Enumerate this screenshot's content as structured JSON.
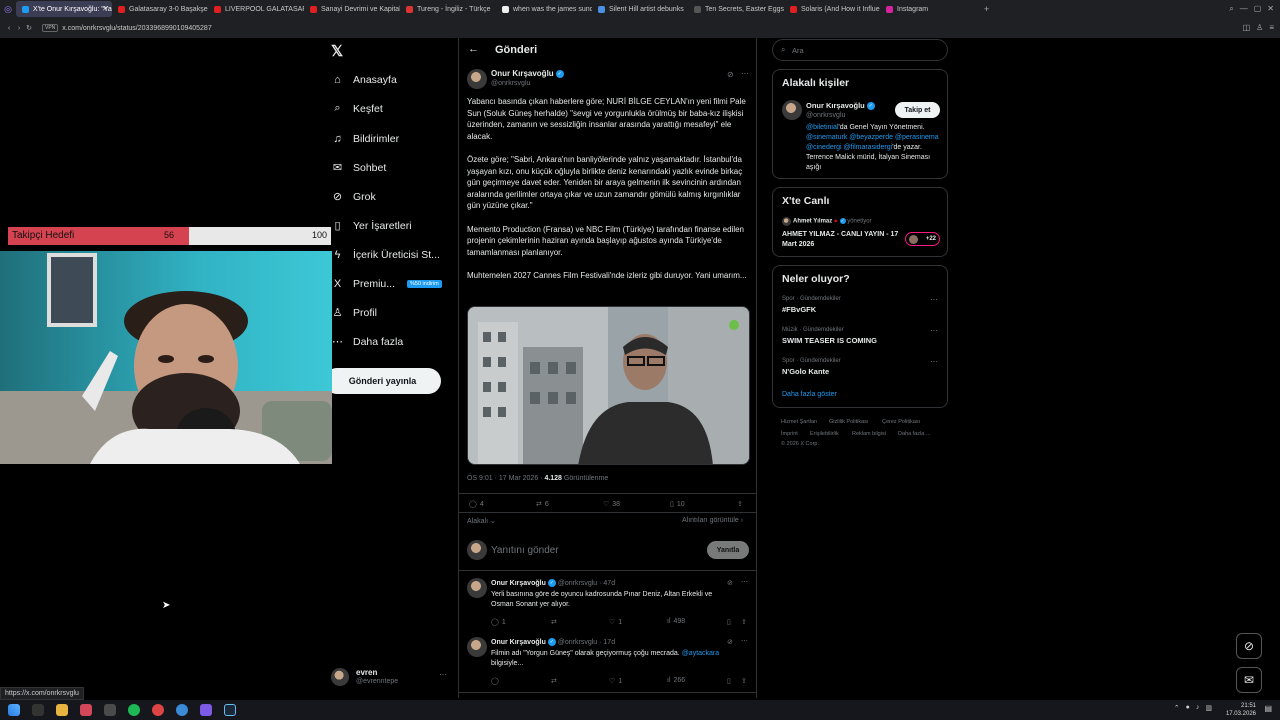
{
  "browser": {
    "tabs": [
      {
        "label": "X'te Onur Kırşavoğlu: \"Ya",
        "color": "#1d9bf0",
        "active": true
      },
      {
        "label": "Galatasaray 3-0 Başakşehir",
        "color": "#e02020"
      },
      {
        "label": "LIVERPOOL GALATASARAY",
        "color": "#e02020"
      },
      {
        "label": "Sanayi Devrimi ve Kapitalizm",
        "color": "#e02020"
      },
      {
        "label": "Tureng - İngiliz - Türkçe",
        "color": "#d33"
      },
      {
        "label": "when was the james sunderl",
        "color": "#eee"
      },
      {
        "label": "Silent Hill artist debunks",
        "color": "#4a90e2"
      },
      {
        "label": "Ten Secrets, Easter Eggs",
        "color": "#555"
      },
      {
        "label": "Solaris (And How it Influen",
        "color": "#e02020"
      },
      {
        "label": "Instagram",
        "color": "#d6249f"
      }
    ],
    "url_badge": "VPN",
    "url": "x.com/onrkrsvglu/status/2033968990109405287",
    "status_url": "https://x.com/onrkrsvglu"
  },
  "nav": {
    "items": [
      {
        "label": "Anasayfa",
        "icon": "home-icon",
        "glyph": "⌂"
      },
      {
        "label": "Keşfet",
        "icon": "search-icon",
        "glyph": "⌕"
      },
      {
        "label": "Bildirimler",
        "icon": "bell-icon",
        "glyph": "♫"
      },
      {
        "label": "Sohbet",
        "icon": "chat-icon",
        "glyph": "✉"
      },
      {
        "label": "Grok",
        "icon": "grok-icon",
        "glyph": "⊘"
      },
      {
        "label": "Yer İşaretleri",
        "icon": "bookmark-icon",
        "glyph": "▯"
      },
      {
        "label": "İçerik Üreticisi St...",
        "icon": "lightning-icon",
        "glyph": "ϟ"
      },
      {
        "label": "Premiu...",
        "icon": "x-premium-icon",
        "glyph": "X",
        "badge": "%50 indirim"
      },
      {
        "label": "Profil",
        "icon": "person-icon",
        "glyph": "♙"
      },
      {
        "label": "Daha fazla",
        "icon": "more-circle-icon",
        "glyph": "⋯"
      }
    ],
    "post_button": "Gönderi yayınla",
    "account": {
      "name": "evren",
      "handle": "@evrenntepe"
    }
  },
  "overlay": {
    "goal_label": "Takipçi Hedefi",
    "current": "56",
    "target": "100",
    "progress": 0.56
  },
  "post": {
    "header_title": "Gönderi",
    "author": "Onur Kırşavoğlu",
    "handle": "@onrkrsvglu",
    "p1": "Yabancı basında çıkan haberlere göre; NURİ BİLGE CEYLAN'ın yeni filmi Pale Sun (Soluk Güneş herhalde) \"sevgi ve yorgunlukla örülmüş bir baba-kız ilişkisi üzerinden, zamanın ve sessizliğin insanlar arasında yarattığı mesafeyi\" ele alacak.",
    "p2": "Özete göre; \"Sabri, Ankara'nın banliyölerinde yalnız yaşamaktadır. İstanbul'da yaşayan kızı, onu küçük oğluyla birlikte deniz kenarındaki yazlık evinde birkaç gün geçirmeye davet eder. Yeniden bir araya gelmenin ilk sevincinin ardından aralarında gerilimler ortaya çıkar ve uzun zamandır gömülü kalmış kırgınlıklar gün yüzüne çıkar.\"",
    "p3": "Memento Production (Fransa) ve NBC Film (Türkiye) tarafından finanse edilen projenin çekimlerinin haziran ayında başlayıp ağustos ayında Türkiye'de tamamlanması planlanıyor.",
    "p4": "Muhtemelen 2027 Cannes Film Festivali'nde izleriz gibi duruyor. Yani umarım...",
    "time": "ÖS 9:01 · 17 Mar 2026 · ",
    "views": "4.128",
    "views_label": " Görüntülenme",
    "replies": "4",
    "reposts": "6",
    "likes": "38",
    "bookmarks": "10",
    "relevance": "Alakalı",
    "quotes_link": "Alıntıları görüntüle",
    "reply_placeholder": "Yanıtını gönder",
    "reply_button": "Yanıtla"
  },
  "replies": [
    {
      "author": "Onur Kırşavoğlu",
      "handle": "@onrkrsvglu · 47d",
      "text": "Yerli basınına göre de oyuncu kadrosunda Pınar Deniz, Altan Erkekli ve Osman Sonant yer alıyor.",
      "replies": "1",
      "reposts": "",
      "likes": "1",
      "views": "498"
    },
    {
      "author": "Onur Kırşavoğlu",
      "handle": "@onrkrsvglu · 17d",
      "text_a": "Filmin adı \"Yorgun Güneş\" olarak geçiyormuş çoğu mecrada. ",
      "text_mention": "@aytackara",
      "text_b": " bilgisiyle...",
      "replies": "",
      "reposts": "",
      "likes": "1",
      "views": "266"
    }
  ],
  "right": {
    "search_placeholder": "Ara",
    "related_title": "Alakalı kişiler",
    "related": {
      "name": "Onur Kırşavoğlu",
      "handle": "@onrkrsvglu",
      "follow": "Takip et",
      "bio_m1": "@biletinial",
      "bio_t1": "'da Genel Yayın Yönetmeni.",
      "bio_m2": "@sinematurk @beyazperde @perasinema @cinedergi @filmarasidergi",
      "bio_t2": "'de yazar. Terrence Malick mürid, İtalyan Sineması aşığı"
    },
    "live_title": "X'te Canlı",
    "live": {
      "host": "Ahmet Yılmaz",
      "status": "yönetiyor",
      "title": "AHMET YILMAZ - CANLI YAYIN - 17 Mart 2026",
      "count": "+22"
    },
    "trends_title": "Neler oluyor?",
    "trends": [
      {
        "category": "Spor · Gündemdekiler",
        "name": "#FBvGFK"
      },
      {
        "category": "Müzik · Gündemdekiler",
        "name": "SWIM TEASER IS COMING"
      },
      {
        "category": "Spor · Gündemdekiler",
        "name": "N'Golo Kante"
      }
    ],
    "show_more": "Daha fazla göster",
    "footer": {
      "l1": "Hizmet Şartları",
      "l2": "Gizlilik Politikası",
      "l3": "Çerez Politikası",
      "l4": "İmprint",
      "l5": "Erişilebilirlik",
      "l6": "Reklam bilgisi",
      "l7": "Daha fazla ...",
      "copy": "© 2026 X Corp."
    }
  },
  "clock": {
    "time": "21:51",
    "date": "17.03.2026"
  }
}
